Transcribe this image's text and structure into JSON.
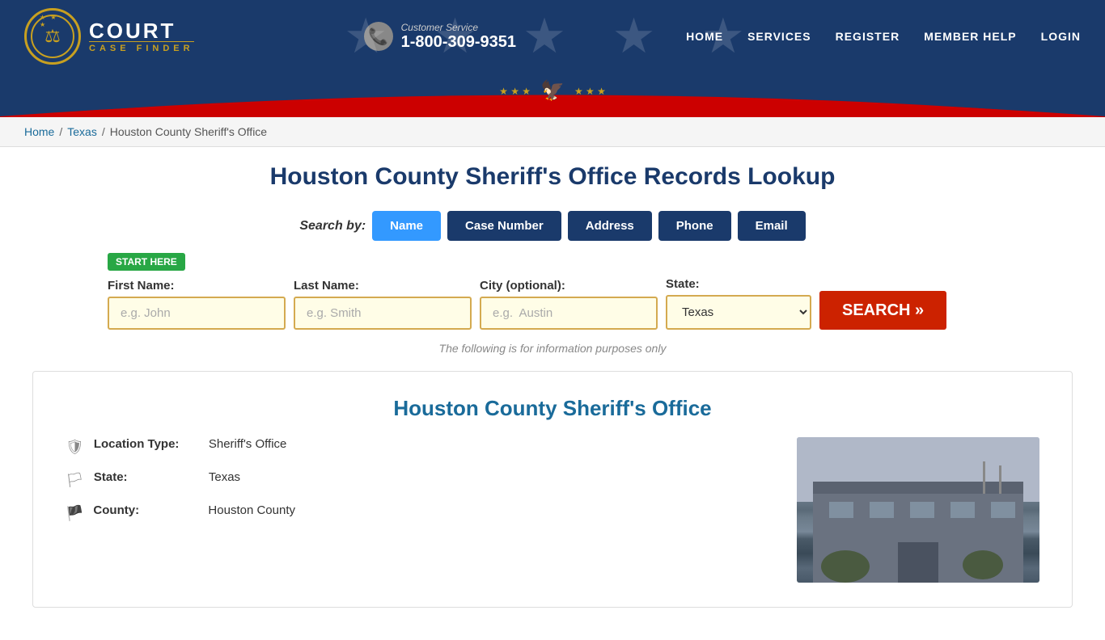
{
  "header": {
    "logo_court": "COURT",
    "logo_case_finder": "CASE FINDER",
    "customer_service_label": "Customer Service",
    "customer_service_phone": "1-800-309-9351",
    "nav": {
      "home": "HOME",
      "services": "SERVICES",
      "register": "REGISTER",
      "member_help": "MEMBER HELP",
      "login": "LOGIN"
    }
  },
  "breadcrumb": {
    "home": "Home",
    "texas": "Texas",
    "current": "Houston County Sheriff's Office"
  },
  "page": {
    "title": "Houston County Sheriff's Office Records Lookup",
    "search_by_label": "Search by:",
    "tabs": [
      {
        "id": "name",
        "label": "Name",
        "active": true
      },
      {
        "id": "case-number",
        "label": "Case Number",
        "active": false
      },
      {
        "id": "address",
        "label": "Address",
        "active": false
      },
      {
        "id": "phone",
        "label": "Phone",
        "active": false
      },
      {
        "id": "email",
        "label": "Email",
        "active": false
      }
    ],
    "start_here": "START HERE",
    "form": {
      "first_name_label": "First Name:",
      "first_name_placeholder": "e.g. John",
      "last_name_label": "Last Name:",
      "last_name_placeholder": "e.g. Smith",
      "city_label": "City (optional):",
      "city_placeholder": "e.g.  Austin",
      "state_label": "State:",
      "state_value": "Texas",
      "search_button": "SEARCH »"
    },
    "info_note": "The following is for information purposes only",
    "info_card": {
      "title": "Houston County Sheriff's Office",
      "rows": [
        {
          "icon": "🛡",
          "label": "Location Type:",
          "value": "Sheriff's Office"
        },
        {
          "icon": "🏳",
          "label": "State:",
          "value": "Texas"
        },
        {
          "icon": "🏴",
          "label": "County:",
          "value": "Houston County"
        }
      ]
    }
  }
}
